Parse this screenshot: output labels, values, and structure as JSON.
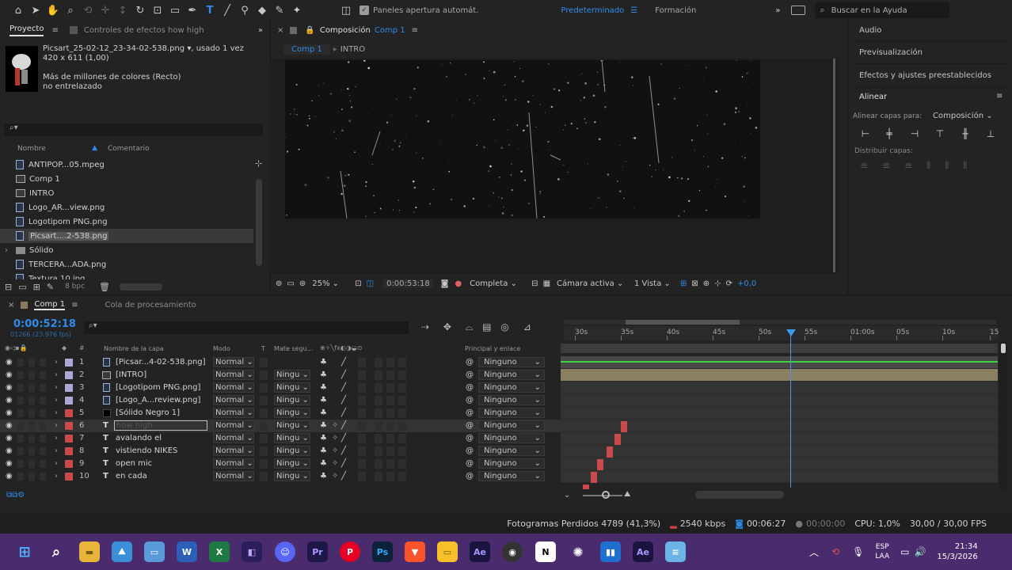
{
  "toolbar": {
    "auto_open_label": "Paneles apertura automát.",
    "workspace_active": "Predeterminado",
    "workspace_other": "Formación",
    "search_placeholder": "Buscar en la Ayuda"
  },
  "project_panel": {
    "tab_project": "Proyecto",
    "tab_effects": "Controles de efectos how high",
    "selected_file": "Picsart_25-02-12_23-34-02-538.png",
    "used_count": ", usado 1 vez",
    "dimensions": "420 x 611 (1,00)",
    "color_info": "Más de millones de colores (Recto)",
    "interlace": "no entrelazado",
    "col_name": "Nombre",
    "col_comment": "Comentario",
    "items": [
      {
        "name": "ANTIPOP...05.mpeg",
        "type": "file"
      },
      {
        "name": "Comp 1",
        "type": "comp"
      },
      {
        "name": "INTRO",
        "type": "comp"
      },
      {
        "name": "Logo_AR...view.png",
        "type": "file"
      },
      {
        "name": "Logotipom PNG.png",
        "type": "file"
      },
      {
        "name": "Picsart....2-538.png",
        "type": "file",
        "selected": true
      },
      {
        "name": "Sólido",
        "type": "folder"
      },
      {
        "name": "TERCERA...ADA.png",
        "type": "file"
      },
      {
        "name": "Textura 10.jpg",
        "type": "file"
      }
    ],
    "bpc": "8 bpc"
  },
  "composition_panel": {
    "title": "Composición",
    "comp_name": "Comp 1",
    "breadcrumb": [
      "Comp 1",
      "INTRO"
    ],
    "zoom": "25%",
    "timecode": "0:00:53:18",
    "resolution": "Completa",
    "camera": "Cámara activa",
    "views": "1 Vista",
    "exposure": "+0,0"
  },
  "right_panel": {
    "items": [
      "Audio",
      "Previsualización",
      "Efectos y ajustes preestablecidos",
      "Alinear"
    ],
    "align_to_label": "Alinear capas para:",
    "align_to_value": "Composición",
    "distribute_label": "Distribuir capas:"
  },
  "timeline": {
    "tab_comp": "Comp 1",
    "tab_render": "Cola de procesamiento",
    "current_time": "0:00:52:18",
    "frame_info": "01266 (23.976 fps)",
    "headers": {
      "layer_name": "Nombre de la capa",
      "mode": "Modo",
      "t": "T",
      "matte": "Mate segu...",
      "parent": "Principal y enlace"
    },
    "ruler_labels": [
      "30s",
      "35s",
      "40s",
      "45s",
      "50s",
      "55s",
      "01:00s",
      "05s",
      "10s",
      "15"
    ],
    "layers": [
      {
        "num": "1",
        "name": "[Picsar...4-02-538.png]",
        "color": "#a9a9d4",
        "mode": "Normal",
        "matte": "",
        "parent": "Ninguno",
        "type": "footage"
      },
      {
        "num": "2",
        "name": "[INTRO]",
        "color": "#a9a9d4",
        "mode": "Normal",
        "matte": "Ningu",
        "parent": "Ninguno",
        "type": "comp"
      },
      {
        "num": "3",
        "name": "[Logotipom PNG.png]",
        "color": "#a9a9d4",
        "mode": "Normal",
        "matte": "Ningu",
        "parent": "Ninguno",
        "type": "footage"
      },
      {
        "num": "4",
        "name": "[Logo_A...review.png]",
        "color": "#a9a9d4",
        "mode": "Normal",
        "matte": "Ningu",
        "parent": "Ninguno",
        "type": "footage"
      },
      {
        "num": "5",
        "name": "[Sólido Negro 1]",
        "color": "#c84a4a",
        "mode": "Normal",
        "matte": "Ningu",
        "parent": "Ninguno",
        "type": "solid"
      },
      {
        "num": "6",
        "name": "how high",
        "color": "#c84a4a",
        "mode": "Normal",
        "matte": "Ningu",
        "parent": "Ninguno",
        "type": "text",
        "selected": true
      },
      {
        "num": "7",
        "name": "avalando el",
        "color": "#c84a4a",
        "mode": "Normal",
        "matte": "Ningu",
        "parent": "Ninguno",
        "type": "text"
      },
      {
        "num": "8",
        "name": "vistiendo NIKES",
        "color": "#c84a4a",
        "mode": "Normal",
        "matte": "Ningu",
        "parent": "Ninguno",
        "type": "text"
      },
      {
        "num": "9",
        "name": "open mic",
        "color": "#c84a4a",
        "mode": "Normal",
        "matte": "Ningu",
        "parent": "Ninguno",
        "type": "text"
      },
      {
        "num": "10",
        "name": "en cada",
        "color": "#c84a4a",
        "mode": "Normal",
        "matte": "Ningu",
        "parent": "Ninguno",
        "type": "text"
      }
    ]
  },
  "status_bar": {
    "dropped_frames": "Fotogramas Perdidos 4789 (41,3%)",
    "bitrate": "2540 kbps",
    "duration": "00:06:27",
    "time2": "00:00:00",
    "cpu": "CPU: 1,0%",
    "fps": "30,00 / 30,00 FPS"
  },
  "taskbar": {
    "lang_top": "ESP",
    "lang_bottom": "LAA",
    "time": "21:34",
    "date": "15/3/2026"
  },
  "colors": {
    "accent": "#2d8ceb",
    "playhead": "#3b9cf0",
    "taskbar": "#4a2c6e",
    "layer_bar": "#8b7f62",
    "label_red": "#c84a4a",
    "label_lavender": "#a9a9d4"
  }
}
